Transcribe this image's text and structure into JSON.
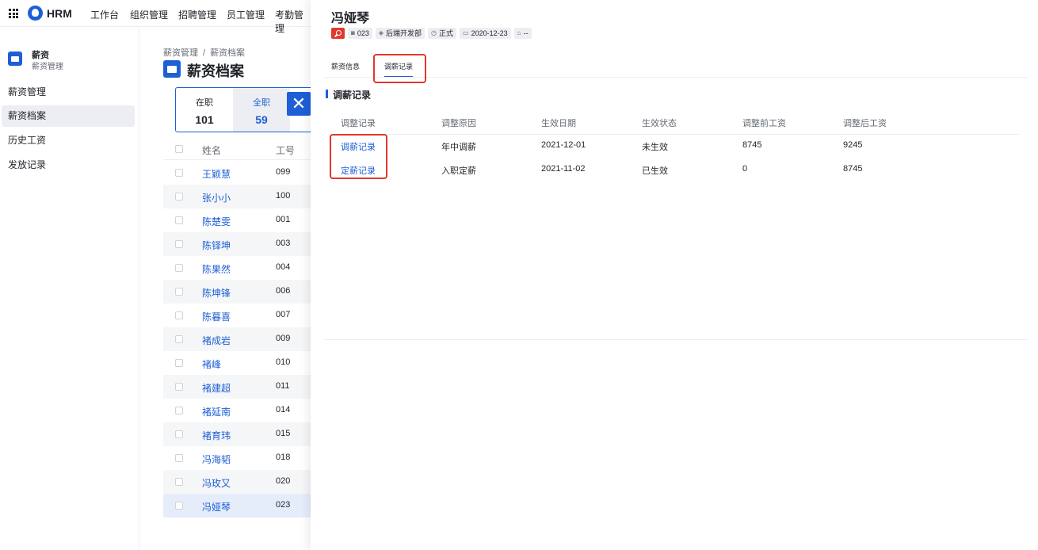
{
  "app": {
    "logo_text": "HRM"
  },
  "topnav": [
    "工作台",
    "组织管理",
    "招聘管理",
    "员工管理",
    "考勤管理"
  ],
  "sidebar": {
    "title": "薪资",
    "subtitle": "薪资管理",
    "items": [
      {
        "label": "薪资管理",
        "active": false
      },
      {
        "label": "薪资档案",
        "active": true
      },
      {
        "label": "历史工资",
        "active": false
      },
      {
        "label": "发放记录",
        "active": false
      }
    ]
  },
  "breadcrumb": {
    "parent": "薪资管理",
    "sep": "/",
    "current": "薪资档案"
  },
  "page_title": "薪资档案",
  "stats": {
    "on_job": {
      "label": "在职",
      "value": "101"
    },
    "all": {
      "label": "全职",
      "value": "59"
    }
  },
  "list": {
    "headers": {
      "name": "姓名",
      "id": "工号"
    },
    "rows": [
      {
        "name": "王颖慧",
        "id": "099"
      },
      {
        "name": "张小小",
        "id": "100"
      },
      {
        "name": "陈楚雯",
        "id": "001"
      },
      {
        "name": "陈铎坤",
        "id": "003"
      },
      {
        "name": "陈果然",
        "id": "004"
      },
      {
        "name": "陈坤锋",
        "id": "006"
      },
      {
        "name": "陈暮喜",
        "id": "007"
      },
      {
        "name": "褚成岩",
        "id": "009"
      },
      {
        "name": "褚峰",
        "id": "010"
      },
      {
        "name": "褚建超",
        "id": "011"
      },
      {
        "name": "褚延南",
        "id": "014"
      },
      {
        "name": "褚育玮",
        "id": "015"
      },
      {
        "name": "冯海韬",
        "id": "018"
      },
      {
        "name": "冯玫又",
        "id": "020"
      },
      {
        "name": "冯娅琴",
        "id": "023"
      }
    ]
  },
  "drawer": {
    "employee_name": "冯娅琴",
    "tags": {
      "id": "023",
      "department": "后端开发部",
      "status": "正式",
      "date": "2020-12-23",
      "extra": "--"
    },
    "tabs": [
      "薪资信息",
      "调薪记录"
    ],
    "section_title": "调薪记录",
    "table": {
      "headers": [
        "调整记录",
        "调整原因",
        "生效日期",
        "生效状态",
        "调整前工资",
        "调整后工资"
      ],
      "rows": [
        {
          "record": "调薪记录",
          "reason": "年中调薪",
          "date": "2021-12-01",
          "status": "未生效",
          "before": "8745",
          "after": "9245"
        },
        {
          "record": "定薪记录",
          "reason": "入职定薪",
          "date": "2021-11-02",
          "status": "已生效",
          "before": "0",
          "after": "8745"
        }
      ]
    }
  },
  "colors": {
    "accent": "#1e5fd6",
    "highlight": "#e0392b"
  }
}
